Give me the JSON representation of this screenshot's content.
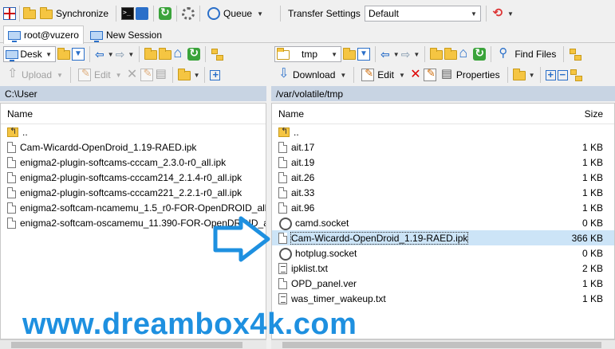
{
  "toolbar_top": {
    "synchronize_label": "Synchronize",
    "queue_label": "Queue",
    "transfer_settings_label": "Transfer Settings",
    "transfer_settings_value": "Default"
  },
  "tabs": {
    "session_label": "root@vuzero",
    "new_session_label": "New Session"
  },
  "left_pane": {
    "drive_value": "Desk",
    "upload_label": "Upload",
    "edit_label": "Edit",
    "path": "C:\\User",
    "column_name": "Name",
    "files": [
      {
        "name": "..",
        "icon": "parent-folder-icon"
      },
      {
        "name": "Cam-Wicardd-OpenDroid_1.19-RAED.ipk",
        "icon": "file-icon"
      },
      {
        "name": "enigma2-plugin-softcams-cccam_2.3.0-r0_all.ipk",
        "icon": "file-icon"
      },
      {
        "name": "enigma2-plugin-softcams-cccam214_2.1.4-r0_all.ipk",
        "icon": "file-icon"
      },
      {
        "name": "enigma2-plugin-softcams-cccam221_2.2.1-r0_all.ipk",
        "icon": "file-icon"
      },
      {
        "name": "enigma2-softcam-ncamemu_1.5_r0-FOR-OpenDROID_all.",
        "icon": "file-icon"
      },
      {
        "name": "enigma2-softcam-oscamemu_11.390-FOR-OpenDROID_a",
        "icon": "file-icon"
      }
    ]
  },
  "right_pane": {
    "dir_value": "tmp",
    "find_files_label": "Find Files",
    "download_label": "Download",
    "edit_label": "Edit",
    "properties_label": "Properties",
    "path": "/var/volatile/tmp",
    "column_name": "Name",
    "column_size": "Size",
    "files": [
      {
        "name": "..",
        "size": "",
        "icon": "parent-folder-icon",
        "selected": false
      },
      {
        "name": "ait.17",
        "size": "1 KB",
        "icon": "file-icon",
        "selected": false
      },
      {
        "name": "ait.19",
        "size": "1 KB",
        "icon": "file-icon",
        "selected": false
      },
      {
        "name": "ait.26",
        "size": "1 KB",
        "icon": "file-icon",
        "selected": false
      },
      {
        "name": "ait.33",
        "size": "1 KB",
        "icon": "file-icon",
        "selected": false
      },
      {
        "name": "ait.96",
        "size": "1 KB",
        "icon": "file-icon",
        "selected": false
      },
      {
        "name": "camd.socket",
        "size": "0 KB",
        "icon": "socket-icon",
        "selected": false
      },
      {
        "name": "Cam-Wicardd-OpenDroid_1.19-RAED.ipk",
        "size": "366 KB",
        "icon": "file-icon",
        "selected": true
      },
      {
        "name": "hotplug.socket",
        "size": "0 KB",
        "icon": "socket-icon",
        "selected": false
      },
      {
        "name": "ipklist.txt",
        "size": "2 KB",
        "icon": "text-file-icon",
        "selected": false
      },
      {
        "name": "OPD_panel.ver",
        "size": "1 KB",
        "icon": "file-icon",
        "selected": false
      },
      {
        "name": "was_timer_wakeup.txt",
        "size": "1 KB",
        "icon": "text-file-icon",
        "selected": false
      }
    ]
  },
  "watermark": "www.dreambox4k.com",
  "colors": {
    "accent": "#1e90e0",
    "path_bar": "#c8d4e3",
    "selection": "#cce4f7"
  }
}
